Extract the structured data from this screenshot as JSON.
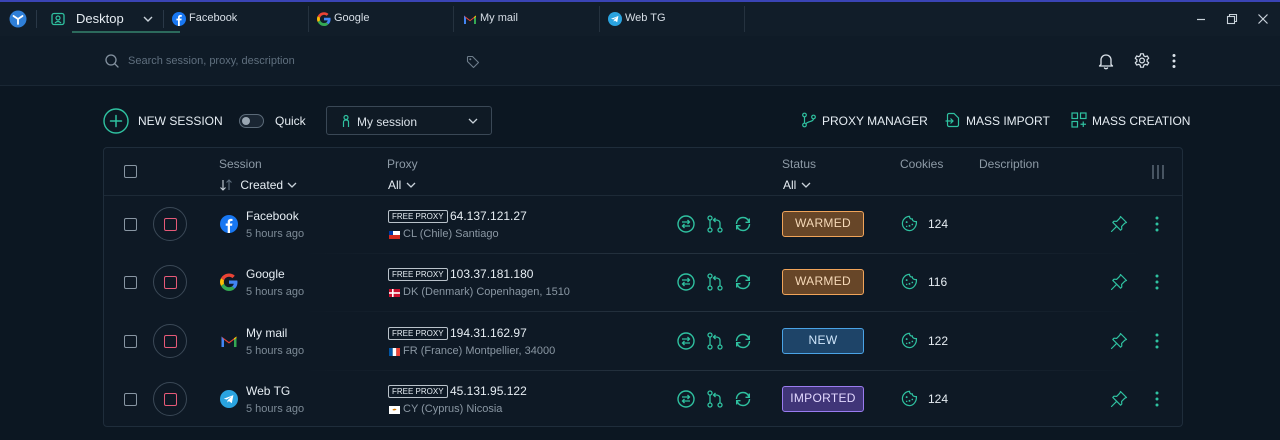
{
  "titlebar": {
    "workspace": "Desktop",
    "tabs": [
      {
        "label": "Facebook",
        "icon": "facebook-icon"
      },
      {
        "label": "Google",
        "icon": "google-icon"
      },
      {
        "label": "My mail",
        "icon": "gmail-icon"
      },
      {
        "label": "Web TG",
        "icon": "telegram-icon"
      }
    ]
  },
  "search": {
    "placeholder": "Search session, proxy, description"
  },
  "toolbar": {
    "new_session": "NEW SESSION",
    "quick": "Quick",
    "quick_enabled": false,
    "session_select": "My session",
    "proxy_manager": "PROXY MANAGER",
    "mass_import": "MASS IMPORT",
    "mass_creation": "MASS CREATION"
  },
  "table": {
    "headers": {
      "session": "Session",
      "session_sort": "Created",
      "proxy": "Proxy",
      "proxy_filter": "All",
      "status": "Status",
      "status_filter": "All",
      "cookies": "Cookies",
      "description": "Description"
    },
    "rows": [
      {
        "name": "Facebook",
        "time": "5 hours ago",
        "icon": "facebook-icon",
        "proxy_badge": "FREE PROXY",
        "ip": "64.137.121.27",
        "flag": "flag-cl",
        "location": "CL (Chile) Santiago",
        "status": "WARMED",
        "cookies": "124"
      },
      {
        "name": "Google",
        "time": "5 hours ago",
        "icon": "google-icon",
        "proxy_badge": "FREE PROXY",
        "ip": "103.37.181.180",
        "flag": "flag-dk",
        "location": "DK (Denmark) Copenhagen, 1510",
        "status": "WARMED",
        "cookies": "116"
      },
      {
        "name": "My mail",
        "time": "5 hours ago",
        "icon": "gmail-icon",
        "proxy_badge": "FREE PROXY",
        "ip": "194.31.162.97",
        "flag": "flag-fr",
        "location": "FR (France) Montpellier, 34000",
        "status": "NEW",
        "cookies": "122"
      },
      {
        "name": "Web TG",
        "time": "5 hours ago",
        "icon": "telegram-icon",
        "proxy_badge": "FREE PROXY",
        "ip": "45.131.95.122",
        "flag": "flag-cy",
        "location": "CY (Cyprus) Nicosia",
        "status": "IMPORTED",
        "cookies": "124"
      }
    ]
  },
  "colors": {
    "accent": "#2fc1a0",
    "warmed": "#f0a45a",
    "new": "#4aa3e6",
    "imported": "#9a7cf0",
    "stop": "#e65a78"
  }
}
